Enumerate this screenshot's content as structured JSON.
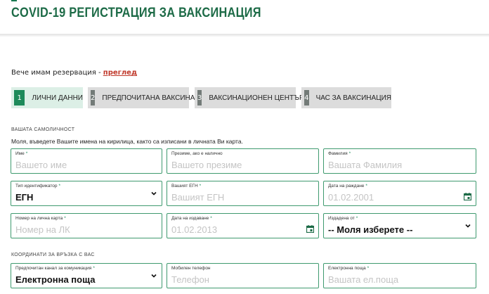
{
  "header": {
    "title": "COVID-19 РЕГИСТРАЦИЯ ЗА ВАКСИНАЦИЯ"
  },
  "reservation": {
    "text": "Вече имам резервация - ",
    "link": "преглед"
  },
  "steps": [
    {
      "num": "1",
      "label": "ЛИЧНИ ДАННИ",
      "active": true
    },
    {
      "num": "2",
      "label": "ПРЕДПОЧИТАНА ВАКСИНА",
      "active": false
    },
    {
      "num": "3",
      "label": "ВАКСИНАЦИОНЕН ЦЕНТЪР",
      "active": false
    },
    {
      "num": "4",
      "label": "ЧАС ЗА ВАКСИНАЦИЯ",
      "active": false
    }
  ],
  "identity": {
    "heading": "ВАШАТА САМОЛИЧНОСТ",
    "instruction": "Моля, въведете Вашите имена на кирилица, както са изписани в личната Ви карта.",
    "first_name": {
      "label": "Име",
      "placeholder": "Вашето име"
    },
    "middle_name": {
      "label": "Презиме, ако е налично",
      "placeholder": "Вашето презиме"
    },
    "last_name": {
      "label": "Фамилия",
      "placeholder": "Вашата Фамилия"
    },
    "id_type": {
      "label": "Тип идентификатор",
      "value": "ЕГН"
    },
    "egn": {
      "label": "Вашият ЕГН",
      "placeholder": "Вашият ЕГН"
    },
    "birth_date": {
      "label": "Дата на раждане",
      "placeholder": "01.02.2001"
    },
    "id_card": {
      "label": "Номер на лична карта",
      "placeholder": "Номер на ЛК"
    },
    "issue_date": {
      "label": "Дата на издаване",
      "placeholder": "01.02.2013"
    },
    "issued_by": {
      "label": "Издадена от",
      "value": "-- Моля изберете --"
    }
  },
  "contacts": {
    "heading": "КООРДИНАТИ ЗА ВРЪЗКА С ВАС",
    "channel": {
      "label": "Предпочитан канал за комуникация",
      "value": "Електронна поща"
    },
    "phone": {
      "label": "Мобилен телефон",
      "placeholder": "Телефон"
    },
    "email": {
      "label": "Електронна поща",
      "placeholder": "Вашата ел.поща"
    }
  },
  "colors": {
    "accent": "#1d8a5a",
    "title": "#1d6b47",
    "link": "#c0392b",
    "border": "#3f9a6f"
  }
}
